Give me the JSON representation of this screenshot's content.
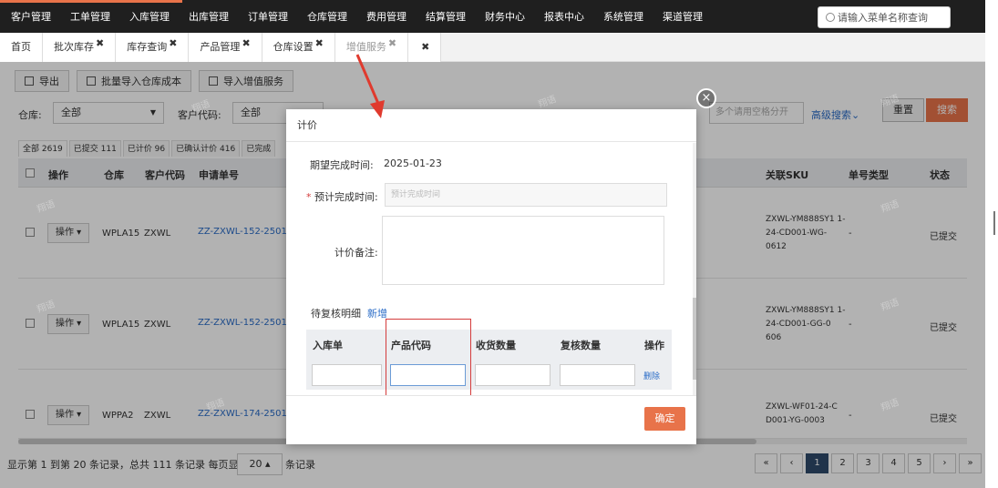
{
  "topnav": {
    "items": [
      "客户管理",
      "工单管理",
      "入库管理",
      "出库管理",
      "订单管理",
      "仓库管理",
      "费用管理",
      "结算管理",
      "财务中心",
      "报表中心",
      "系统管理",
      "渠道管理"
    ],
    "search_placeholder": "请输入菜单名称查询"
  },
  "tabs": [
    {
      "label": "首页",
      "closable": false
    },
    {
      "label": "批次库存",
      "closable": true
    },
    {
      "label": "库存查询",
      "closable": true
    },
    {
      "label": "产品管理",
      "closable": true
    },
    {
      "label": "仓库设置",
      "closable": true
    },
    {
      "label": "增值服务",
      "closable": true,
      "active": true
    }
  ],
  "tab_close_all": "✖",
  "toolbar": {
    "export": "导出",
    "import_cost": "批量导入仓库成本",
    "import_vas": "导入增值服务"
  },
  "filters": {
    "warehouse_label": "仓库:",
    "warehouse_value": "全部",
    "customer_label": "客户代码:",
    "customer_value": "全部",
    "related_placeholder": "多个请用空格分开",
    "advanced": "高级搜索⌄",
    "reset": "重置",
    "search": "搜索"
  },
  "status_tabs": [
    "全部 2619",
    "已提交 111",
    "已计价 96",
    "已确认计价 416",
    "已完成"
  ],
  "table": {
    "headers": {
      "op": "操作",
      "warehouse": "仓库",
      "customer": "客户代码",
      "app_no": "申请单号",
      "sku": "关联SKU",
      "order_type": "单号类型",
      "status": "状态"
    },
    "op_label": "操作",
    "rows": [
      {
        "warehouse": "WPLA15",
        "customer": "ZXWL",
        "app_no": "ZZ-ZXWL-152-250117",
        "sku": "ZXWL-YM888SY1 1-24-CD001-WG- 0612",
        "order_type": "-",
        "status": "已提交"
      },
      {
        "warehouse": "WPLA15",
        "customer": "ZXWL",
        "app_no": "ZZ-ZXWL-152-250117",
        "sku": "ZXWL-YM888SY1 1-24-CD001-GG-0 606",
        "order_type": "-",
        "status": "已提交"
      },
      {
        "warehouse": "WPPA2",
        "customer": "ZXWL",
        "app_no": "ZZ-ZXWL-174-250117",
        "sku": "ZXWL-WF01-24-C D001-YG-0003",
        "order_type": "-",
        "status": "已提交"
      }
    ]
  },
  "pagination": {
    "info": "显示第 1 到第 20 条记录，总共 111 条记录 每页显示",
    "page_size": "20 ▴",
    "suffix": "条记录",
    "pages": [
      "«",
      "‹",
      "1",
      "2",
      "3",
      "4",
      "5",
      "›",
      "»"
    ]
  },
  "watermark": "翔语",
  "modal": {
    "title": "计价",
    "expected_label": "期望完成时间:",
    "expected_value": "2025-01-23",
    "estimated_label": "预计完成时间:",
    "estimated_placeholder": "预计完成时间",
    "remark_label": "计价备注:",
    "detail_label": "待复核明细",
    "add_label": "新增",
    "detail_headers": [
      "入库单",
      "产品代码",
      "收货数量",
      "复核数量",
      "操作"
    ],
    "delete_label": "删除",
    "confirm": "确定",
    "close": "×"
  },
  "colors": {
    "accent": "#e8734a",
    "nav": "#1f1f1f",
    "link": "#2a6cc7",
    "highlight": "#d43c3c"
  }
}
